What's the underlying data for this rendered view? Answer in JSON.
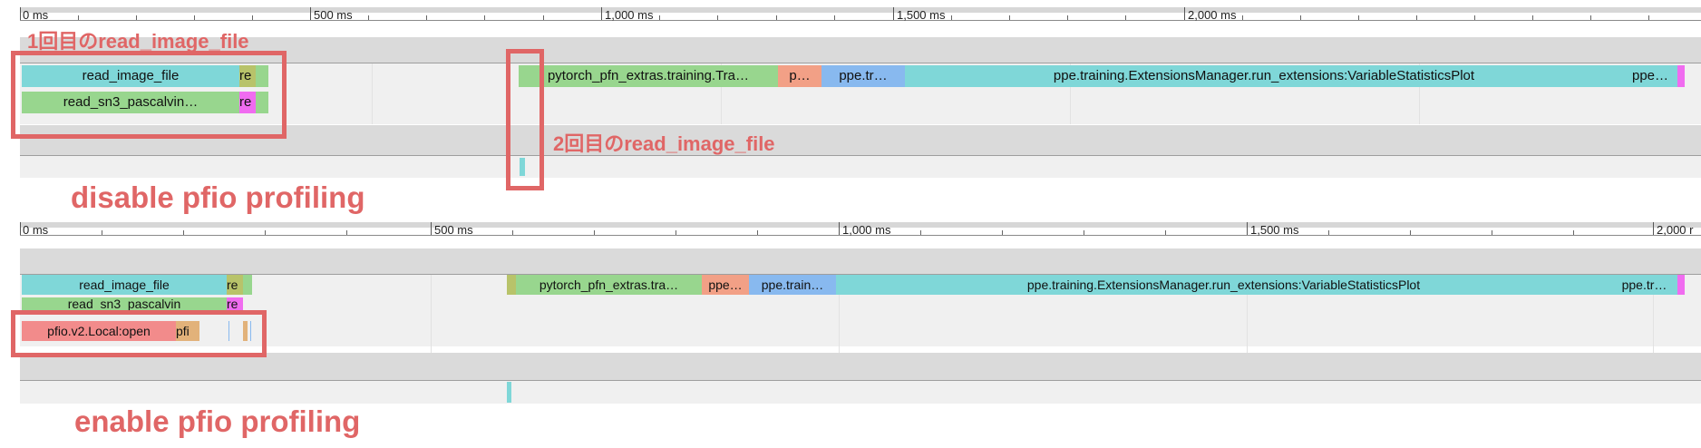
{
  "colors": {
    "teal": "#7fd7d8",
    "green": "#98d68e",
    "olive": "#b8c36a",
    "magenta": "#f06cf0",
    "salmon": "#f2a086",
    "blue": "#88b9ef",
    "pink": "#f28b8b",
    "tan": "#e2b27a",
    "annotation": "#e06666"
  },
  "top": {
    "ruler": {
      "t0": "0 ms",
      "t500": "500 ms",
      "t1000": "1,000 ms",
      "t1500": "1,500 ms",
      "t2000": "2,000 ms"
    },
    "slices": {
      "read_image_file": "read_image_file",
      "re1": "re",
      "read_sn3": "read_sn3_pascalvin…",
      "re2": "re",
      "pytorch": "pytorch_pfn_extras.training.Tra…",
      "p": "p…",
      "ppe_tr": "ppe.tr…",
      "extensions": "ppe.training.ExtensionsManager.run_extensions:VariableStatisticsPlot",
      "ppe_end": "ppe…"
    },
    "annotations": {
      "first": "1回目のread_image_file",
      "second": "2回目のread_image_file"
    },
    "caption": "disable pfio profiling"
  },
  "bottom": {
    "ruler": {
      "t0": "0 ms",
      "t500": "500 ms",
      "t1000": "1,000 ms",
      "t1500": "1,500 ms",
      "t2000": "2,000 r"
    },
    "slices": {
      "read_image_file": "read_image_file",
      "re1": "re",
      "read_sn3": "read_sn3_pascalvin",
      "re2": "re",
      "pfio_open": "pfio.v2.Local:open",
      "pfi": "pfi",
      "pytorch": "pytorch_pfn_extras.tra…",
      "ppe1": "ppe…",
      "ppe_train": "ppe.train…",
      "extensions": "ppe.training.ExtensionsManager.run_extensions:VariableStatisticsPlot",
      "ppe_tr": "ppe.tr…"
    },
    "caption": "enable pfio profiling"
  }
}
